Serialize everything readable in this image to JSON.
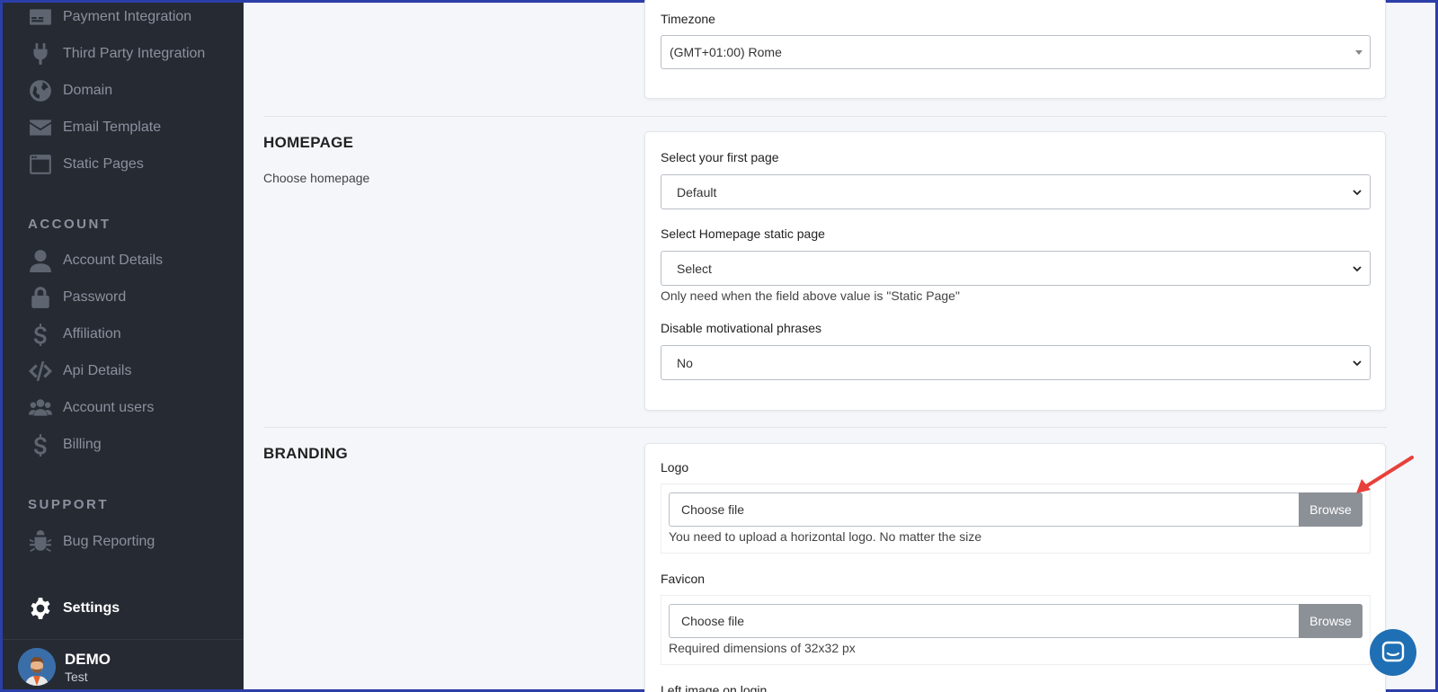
{
  "sidebar": {
    "items_top": [
      {
        "label": "Payment Integration",
        "icon": "payment-icon"
      },
      {
        "label": "Third Party Integration",
        "icon": "plug-icon"
      },
      {
        "label": "Domain",
        "icon": "globe-icon"
      },
      {
        "label": "Email Template",
        "icon": "envelope-icon"
      },
      {
        "label": "Static Pages",
        "icon": "window-icon"
      }
    ],
    "account_label": "ACCOUNT",
    "account_items": [
      {
        "label": "Account Details",
        "icon": "user-icon"
      },
      {
        "label": "Password",
        "icon": "lock-icon"
      },
      {
        "label": "Affiliation",
        "icon": "dollar-icon"
      },
      {
        "label": "Api Details",
        "icon": "code-icon"
      },
      {
        "label": "Account users",
        "icon": "users-icon"
      },
      {
        "label": "Billing",
        "icon": "dollar-icon"
      }
    ],
    "support_label": "SUPPORT",
    "support_items": [
      {
        "label": "Bug Reporting",
        "icon": "bug-icon"
      }
    ],
    "settings_label": "Settings",
    "user": {
      "name": "DEMO",
      "sub": "Test"
    }
  },
  "timezone": {
    "label": "Timezone",
    "value": "(GMT+01:00) Rome"
  },
  "homepage": {
    "title": "HOMEPAGE",
    "desc": "Choose homepage",
    "first_page_label": "Select your first page",
    "first_page_value": "Default",
    "static_page_label": "Select Homepage static page",
    "static_page_value": "Select",
    "static_page_help": "Only need when the field above value is \"Static Page\"",
    "motivational_label": "Disable motivational phrases",
    "motivational_value": "No"
  },
  "branding": {
    "title": "BRANDING",
    "logo_label": "Logo",
    "logo_placeholder": "Choose file",
    "logo_browse": "Browse",
    "logo_help": "You need to upload a horizontal logo. No matter the size",
    "favicon_label": "Favicon",
    "favicon_placeholder": "Choose file",
    "favicon_browse": "Browse",
    "favicon_help": "Required dimensions of 32x32 px",
    "left_image_label": "Left image on login"
  },
  "colors": {
    "sidebar_bg": "#262a33",
    "annotation_arrow": "#e8403a",
    "chat_button": "#1f6fb4"
  }
}
